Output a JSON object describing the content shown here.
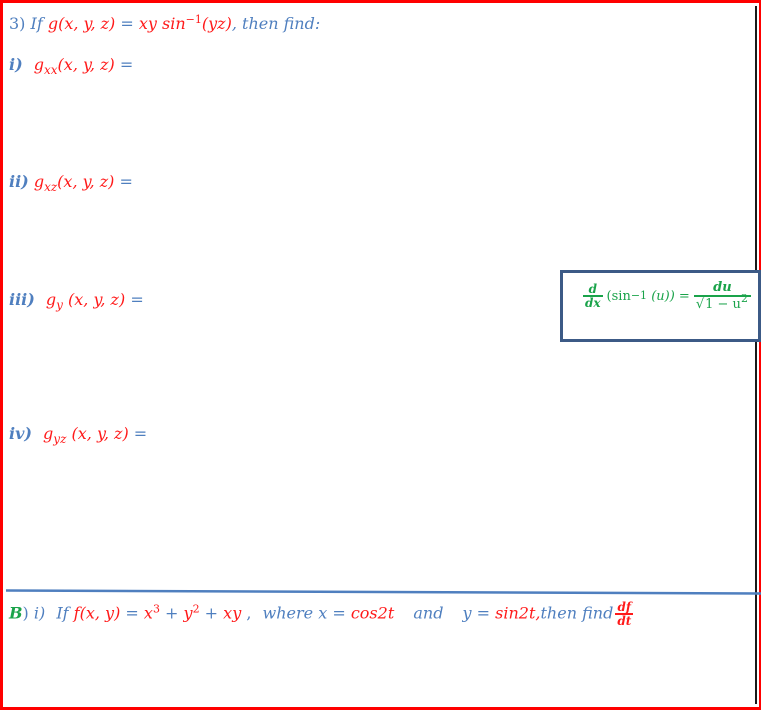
{
  "problem3": {
    "number": "3)",
    "intro": "If",
    "function_lhs": "g(x, y, z)",
    "equals": "=",
    "function_rhs_base": "xy sin",
    "function_rhs_exp": "−1",
    "function_rhs_arg": "(yz)",
    "trailer": ", then find:",
    "parts": [
      {
        "label": "i)",
        "func": "g",
        "sub": "xx",
        "args": "(x, y, z)",
        "equals": "="
      },
      {
        "label": "ii)",
        "func": "g",
        "sub": "xz",
        "args": "(x, y, z)",
        "equals": "="
      },
      {
        "label": "iii)",
        "func": "g",
        "sub": "y",
        "args": "(x, y, z)",
        "equals": "="
      },
      {
        "label": "iv)",
        "func": "g",
        "sub": "yz",
        "args": "(x, y, z)",
        "equals": "="
      }
    ]
  },
  "hint_box": {
    "d_num": "d",
    "d_den": "dx",
    "expr_base": "(sin",
    "expr_exp": "−1",
    "expr_arg": "(u))",
    "equals": "=",
    "rhs_num": "du",
    "rhs_den_prefix": "√",
    "rhs_den_rad": "1 − u",
    "rhs_den_exp": "2"
  },
  "problemB": {
    "letter": "B",
    "paren": ")",
    "part": "i)",
    "intro": "If",
    "lhs": "f(x, y)",
    "equals": "=",
    "rhs_x": "x",
    "rhs_x_exp": "3",
    "plus1": "+",
    "rhs_y": "y",
    "rhs_y_exp": "2",
    "plus2": "+",
    "rhs_xy": "xy",
    "comma": ",",
    "where": "where",
    "x_var": "x",
    "x_eq": "=",
    "x_val": "cos2t",
    "and": "and",
    "y_var": "y",
    "y_eq": "=",
    "y_val": "sin2t,",
    "then_find": "then find",
    "deriv_num": "df",
    "deriv_den": "dt"
  },
  "colors": {
    "border": "#ff0000",
    "label_blue": "#4f7fbf",
    "math_red": "#ff1a1a",
    "accent_green": "#1aa34a",
    "box_border": "#3c5a86",
    "separator": "#4f7fbf"
  }
}
